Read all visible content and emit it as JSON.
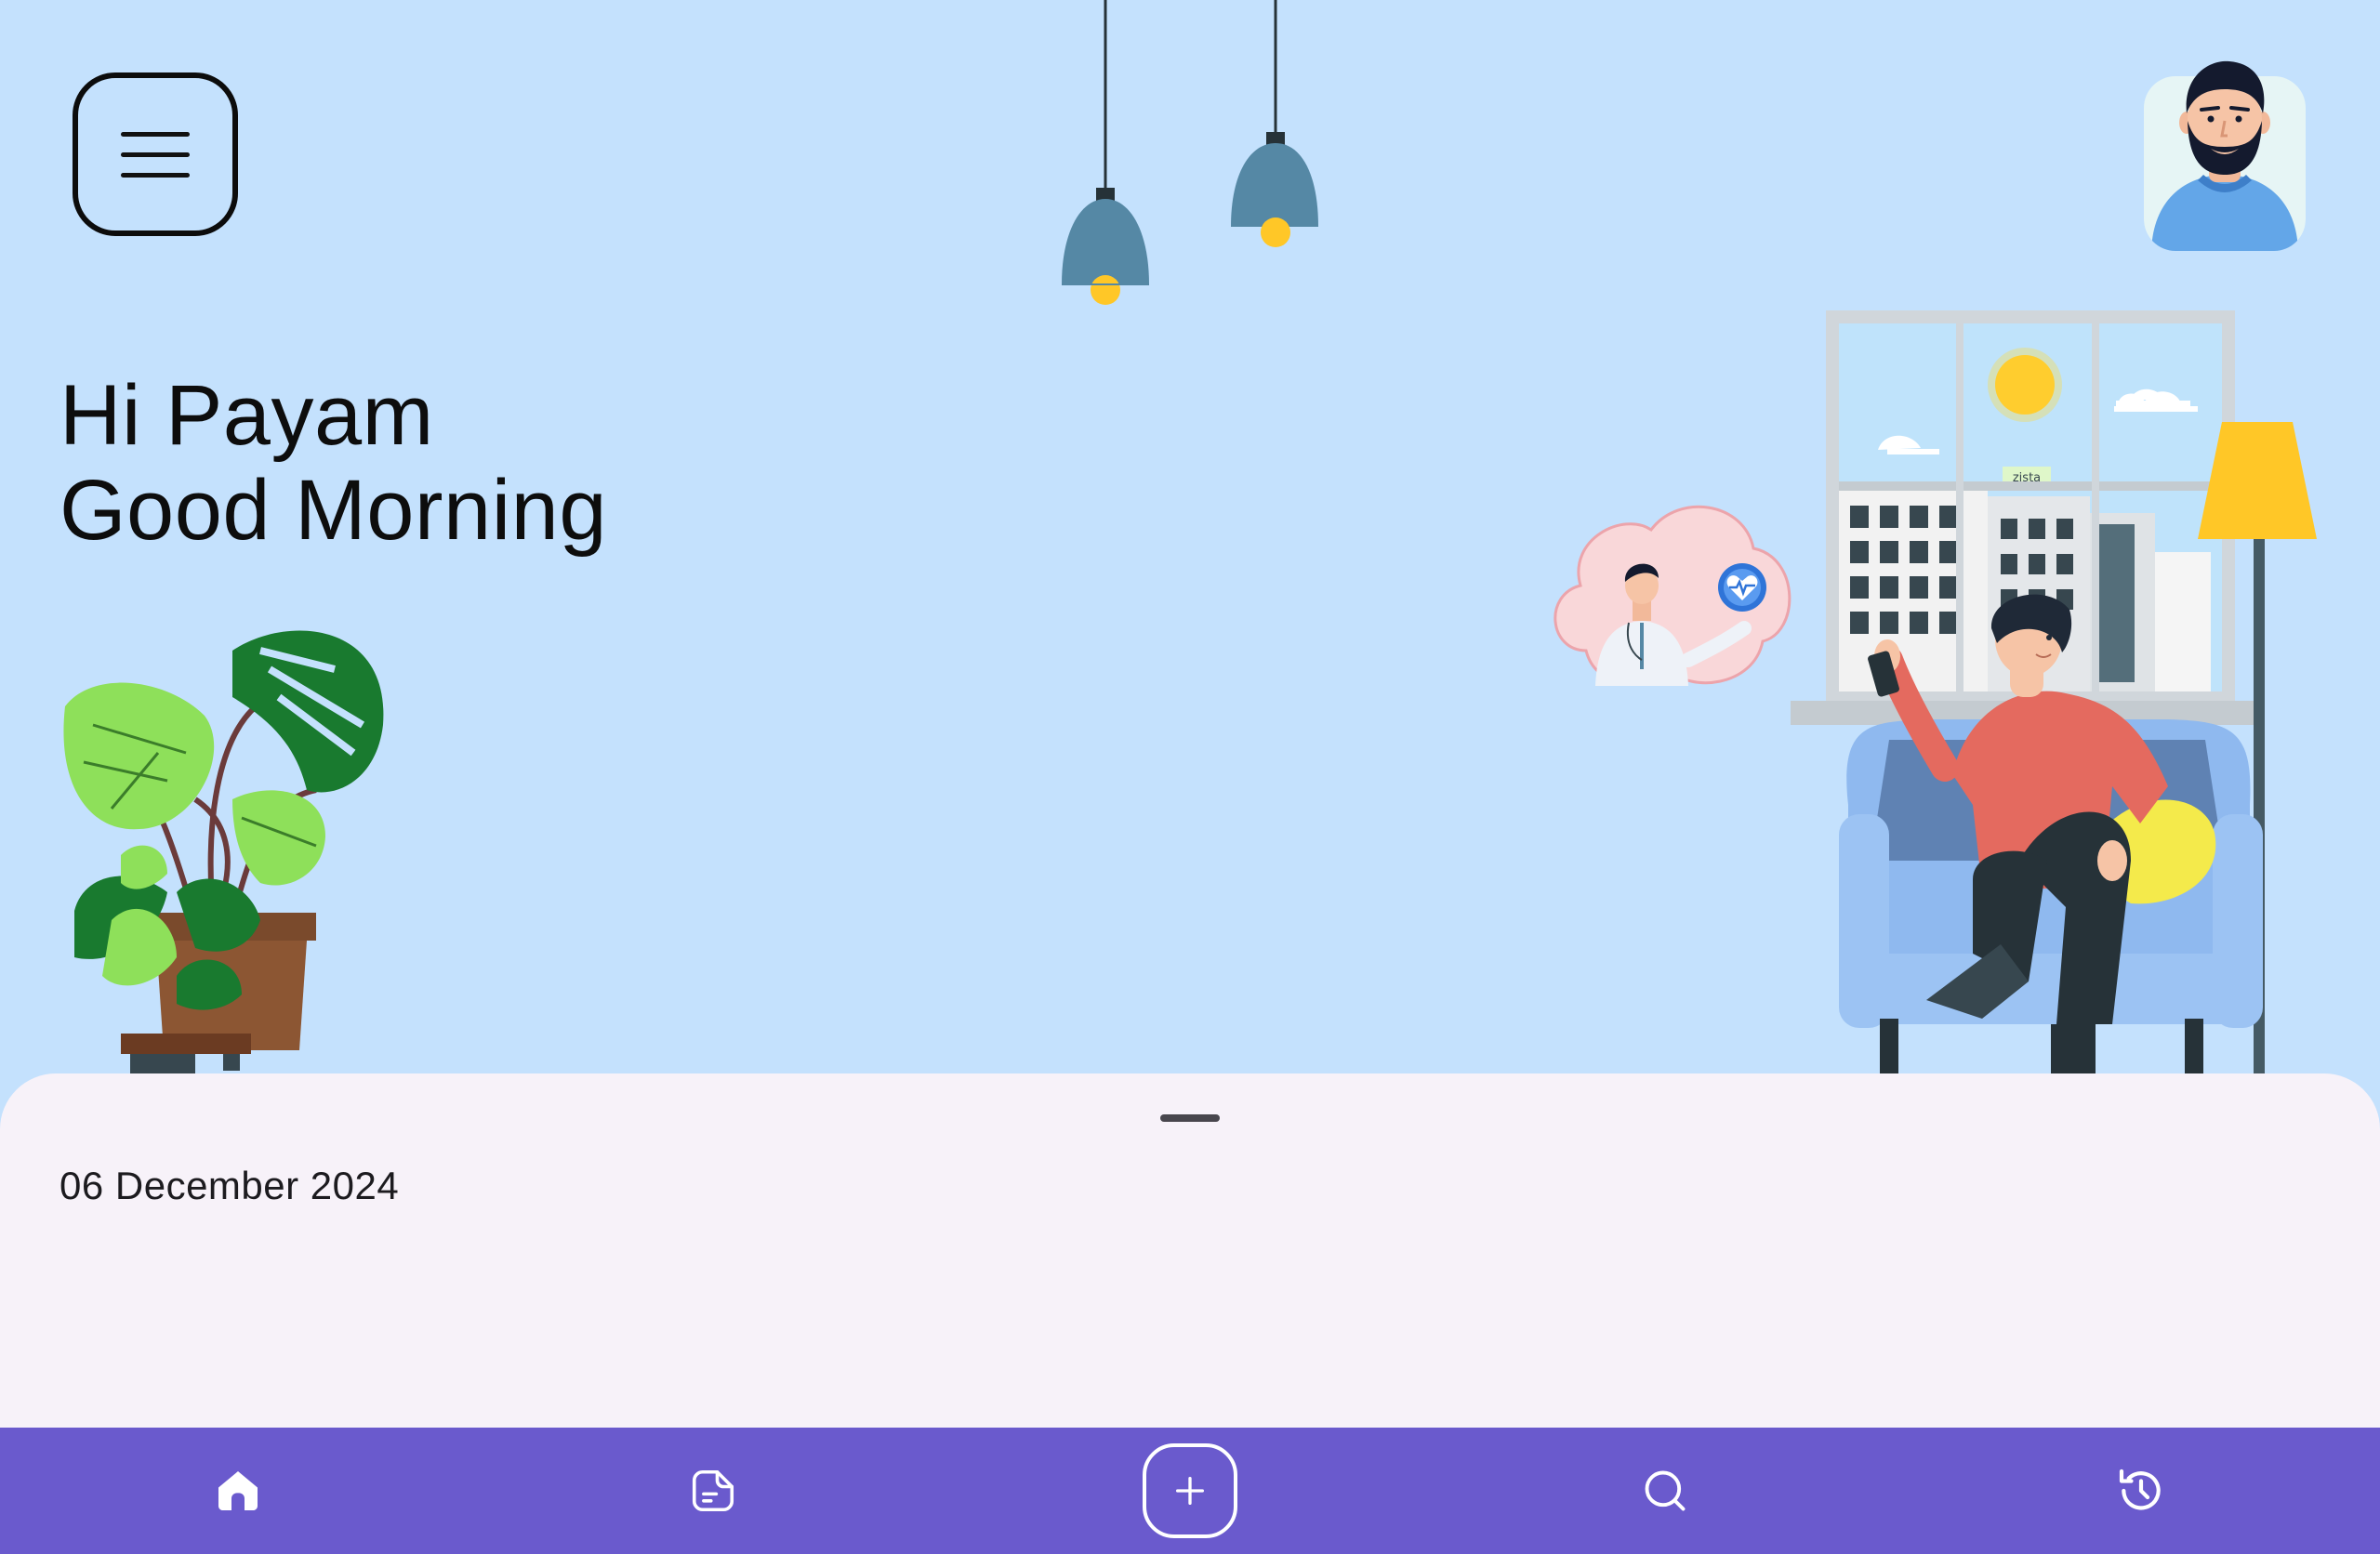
{
  "header": {
    "menu_icon": "hamburger-menu-icon",
    "avatar_icon": "bearded-man-avatar"
  },
  "greeting": {
    "line1": "Hi Payam",
    "line2": "Good Morning"
  },
  "illustration": {
    "building_sign": "zista",
    "thought_bubble_icon": "doctor-heart-pulse-icon"
  },
  "sheet": {
    "date": "06 December 2024"
  },
  "nav": {
    "items": [
      {
        "name": "home",
        "icon": "home-icon",
        "active": true
      },
      {
        "name": "notes",
        "icon": "document-icon",
        "active": false
      },
      {
        "name": "add",
        "icon": "plus-icon",
        "active": false
      },
      {
        "name": "search",
        "icon": "search-icon",
        "active": false
      },
      {
        "name": "history",
        "icon": "history-icon",
        "active": false
      }
    ]
  },
  "colors": {
    "background": "#c4e1fd",
    "sheet": "#f7f2f9",
    "nav": "#6a5acd",
    "text": "#0d0d0d"
  }
}
